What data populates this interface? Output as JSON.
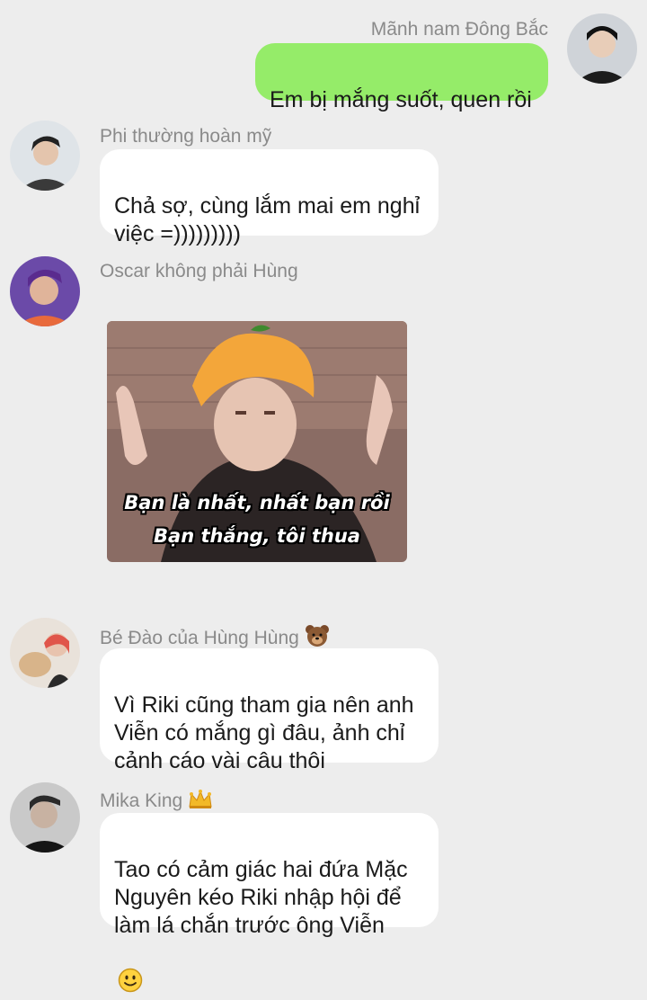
{
  "messages": [
    {
      "sender": "Mãnh nam Đông Bắc",
      "text": "Em bị mắng suốt, quen rồi",
      "self": true
    },
    {
      "sender": "Phi thường hoàn mỹ",
      "text": "Chả sợ, cùng lắm mai em nghỉ việc =)))))))))"
    },
    {
      "sender": "Oscar không phải Hùng",
      "sticker": {
        "line1": "Bạn là nhất, nhất bạn rồi",
        "line2": "Bạn thắng, tôi thua"
      }
    },
    {
      "sender": "Bé Đào của Hùng Hùng",
      "sender_emoji": "bear-face-icon",
      "text": "Vì Riki cũng tham gia nên anh Viễn có mắng gì đâu, ảnh chỉ cảnh cáo vài câu thôi"
    },
    {
      "sender": "Mika King",
      "sender_emoji": "crown-icon",
      "text": "Tao có cảm giác hai đứa Mặc Nguyên kéo Riki nhập hội để làm lá chắn trước ông Viễn",
      "text_emoji": "smiling-face-icon"
    }
  ],
  "colors": {
    "background": "#ededed",
    "self_bubble": "#95ec69",
    "other_bubble": "#ffffff",
    "name_text": "#8a8a8a"
  }
}
